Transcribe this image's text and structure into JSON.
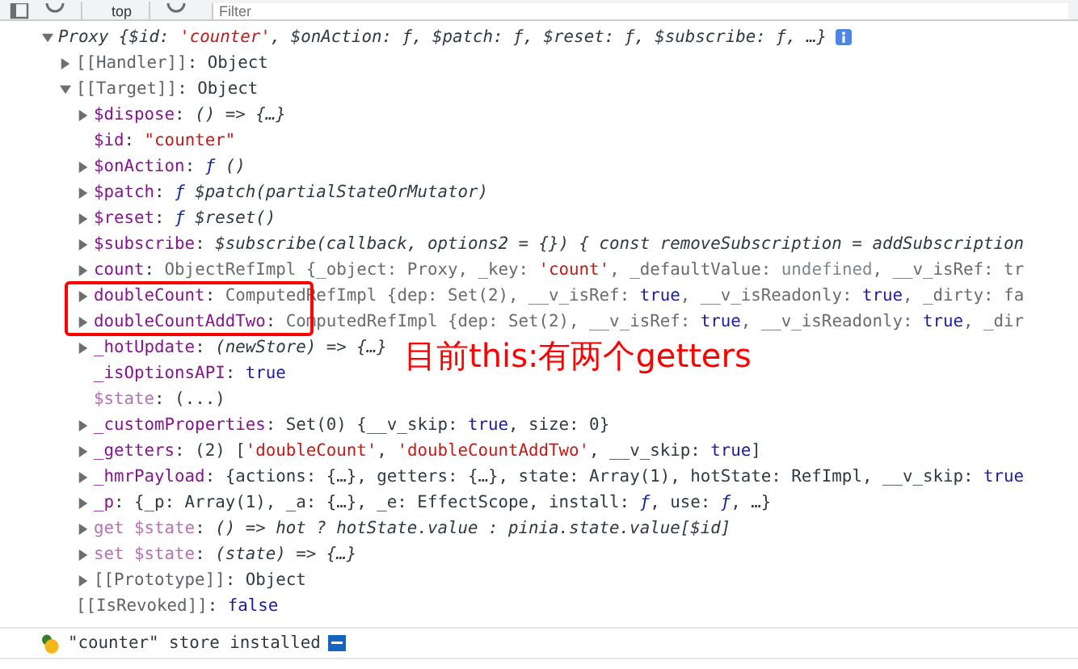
{
  "toolbar": {
    "context": "top",
    "filter": {
      "placeholder": "Filter"
    }
  },
  "console_tree": [
    {
      "kind": "node",
      "expanded": true,
      "segments": [
        {
          "kind": "summary",
          "text": "Proxy {$id: "
        },
        {
          "kind": "summary_string",
          "text": "'counter'"
        },
        {
          "kind": "summary",
          "text": ", $onAction: ƒ, $patch: ƒ, $reset: ƒ, $subscribe: ƒ, …}"
        }
      ],
      "children": [
        {
          "kind": "node",
          "expanded": false,
          "segments": [
            {
              "kind": "internal",
              "text": "[[Handler]]"
            },
            {
              "kind": "plain",
              "text": ": Object"
            }
          ]
        },
        {
          "kind": "node",
          "expanded": true,
          "segments": [
            {
              "kind": "internal",
              "text": "[[Target]]"
            },
            {
              "kind": "plain",
              "text": ": Object"
            }
          ],
          "children": [
            {
              "kind": "node",
              "expanded": false,
              "segments": [
                {
                  "kind": "key",
                  "text": "$dispose"
                },
                {
                  "kind": "plain",
                  "text": ": "
                },
                {
                  "kind": "italic",
                  "text": "() => {…}"
                }
              ]
            },
            {
              "kind": "leaf",
              "segments": [
                {
                  "kind": "key",
                  "text": "$id"
                },
                {
                  "kind": "plain",
                  "text": ": "
                },
                {
                  "kind": "string",
                  "text": "\"counter\""
                }
              ]
            },
            {
              "kind": "node",
              "expanded": false,
              "segments": [
                {
                  "kind": "key",
                  "text": "$onAction"
                },
                {
                  "kind": "plain",
                  "text": ": "
                },
                {
                  "kind": "fn",
                  "text": "ƒ "
                },
                {
                  "kind": "italic",
                  "text": "()"
                }
              ]
            },
            {
              "kind": "node",
              "expanded": false,
              "segments": [
                {
                  "kind": "key",
                  "text": "$patch"
                },
                {
                  "kind": "plain",
                  "text": ": "
                },
                {
                  "kind": "fn",
                  "text": "ƒ "
                },
                {
                  "kind": "italic",
                  "text": "$patch(partialStateOrMutator)"
                }
              ]
            },
            {
              "kind": "node",
              "expanded": false,
              "segments": [
                {
                  "kind": "key",
                  "text": "$reset"
                },
                {
                  "kind": "plain",
                  "text": ": "
                },
                {
                  "kind": "fn",
                  "text": "ƒ "
                },
                {
                  "kind": "italic",
                  "text": "$reset()"
                }
              ]
            },
            {
              "kind": "node",
              "expanded": false,
              "segments": [
                {
                  "kind": "key",
                  "text": "$subscribe"
                },
                {
                  "kind": "plain",
                  "text": ": "
                },
                {
                  "kind": "italic",
                  "text": "$subscribe(callback, options2 = {}) { const removeSubscription = addSubscription"
                }
              ]
            },
            {
              "kind": "node",
              "expanded": false,
              "segments": [
                {
                  "kind": "key",
                  "text": "count"
                },
                {
                  "kind": "plain",
                  "text": ": "
                },
                {
                  "kind": "preview",
                  "text": "ObjectRefImpl {_object: Proxy, _key: "
                },
                {
                  "kind": "string",
                  "text": "'count'"
                },
                {
                  "kind": "preview",
                  "text": ", _defaultValue: "
                },
                {
                  "kind": "undef",
                  "text": "undefined"
                },
                {
                  "kind": "preview",
                  "text": ", __v_isRef: tr"
                }
              ]
            },
            {
              "kind": "node",
              "expanded": false,
              "segments": [
                {
                  "kind": "key",
                  "text": "doubleCount"
                },
                {
                  "kind": "plain",
                  "text": ": "
                },
                {
                  "kind": "preview",
                  "text": "ComputedRefImpl {dep: Set(2), __v_isRef: "
                },
                {
                  "kind": "keyword",
                  "text": "true"
                },
                {
                  "kind": "preview",
                  "text": ", __v_isReadonly: "
                },
                {
                  "kind": "keyword",
                  "text": "true"
                },
                {
                  "kind": "preview",
                  "text": ", _dirty: fa"
                }
              ]
            },
            {
              "kind": "node",
              "expanded": false,
              "segments": [
                {
                  "kind": "key",
                  "text": "doubleCountAddTwo"
                },
                {
                  "kind": "plain",
                  "text": ": "
                },
                {
                  "kind": "preview",
                  "text": "ComputedRefImpl {dep: Set(2), __v_isRef: "
                },
                {
                  "kind": "keyword",
                  "text": "true"
                },
                {
                  "kind": "preview",
                  "text": ", __v_isReadonly: "
                },
                {
                  "kind": "keyword",
                  "text": "true"
                },
                {
                  "kind": "preview",
                  "text": ", _dir"
                }
              ]
            },
            {
              "kind": "node",
              "expanded": false,
              "segments": [
                {
                  "kind": "key",
                  "text": "_hotUpdate"
                },
                {
                  "kind": "plain",
                  "text": ": "
                },
                {
                  "kind": "italic",
                  "text": "(newStore) => {…}"
                }
              ]
            },
            {
              "kind": "leaf",
              "segments": [
                {
                  "kind": "key",
                  "text": "_isOptionsAPI"
                },
                {
                  "kind": "plain",
                  "text": ": "
                },
                {
                  "kind": "keyword",
                  "text": "true"
                }
              ]
            },
            {
              "kind": "leaf",
              "segments": [
                {
                  "kind": "dimkey",
                  "text": "$state"
                },
                {
                  "kind": "plain",
                  "text": ": (...)"
                }
              ]
            },
            {
              "kind": "node",
              "expanded": false,
              "segments": [
                {
                  "kind": "key",
                  "text": "_customProperties"
                },
                {
                  "kind": "plain",
                  "text": ": Set(0) {__v_skip: "
                },
                {
                  "kind": "keyword",
                  "text": "true"
                },
                {
                  "kind": "plain",
                  "text": ", size: 0}"
                }
              ]
            },
            {
              "kind": "node",
              "expanded": false,
              "segments": [
                {
                  "kind": "key",
                  "text": "_getters"
                },
                {
                  "kind": "plain",
                  "text": ": (2) ["
                },
                {
                  "kind": "string",
                  "text": "'doubleCount'"
                },
                {
                  "kind": "plain",
                  "text": ", "
                },
                {
                  "kind": "string",
                  "text": "'doubleCountAddTwo'"
                },
                {
                  "kind": "plain",
                  "text": ", __v_skip: "
                },
                {
                  "kind": "keyword",
                  "text": "true"
                },
                {
                  "kind": "plain",
                  "text": "]"
                }
              ]
            },
            {
              "kind": "node",
              "expanded": false,
              "segments": [
                {
                  "kind": "key",
                  "text": "_hmrPayload"
                },
                {
                  "kind": "plain",
                  "text": ": {actions: {…}, getters: {…}, state: Array(1), hotState: RefImpl, __v_skip: "
                },
                {
                  "kind": "keyword",
                  "text": "true"
                }
              ]
            },
            {
              "kind": "node",
              "expanded": false,
              "segments": [
                {
                  "kind": "key",
                  "text": "_p"
                },
                {
                  "kind": "plain",
                  "text": ": {_p: Array(1), _a: {…}, _e: EffectScope, install: "
                },
                {
                  "kind": "fn",
                  "text": "ƒ"
                },
                {
                  "kind": "plain",
                  "text": ", use: "
                },
                {
                  "kind": "fn",
                  "text": "ƒ"
                },
                {
                  "kind": "plain",
                  "text": ", …}"
                }
              ]
            },
            {
              "kind": "node",
              "expanded": false,
              "segments": [
                {
                  "kind": "dimkey",
                  "text": "get $state"
                },
                {
                  "kind": "plain",
                  "text": ": "
                },
                {
                  "kind": "italic",
                  "text": "() => hot ? hotState.value : pinia.state.value[$id]"
                }
              ]
            },
            {
              "kind": "node",
              "expanded": false,
              "segments": [
                {
                  "kind": "dimkey",
                  "text": "set $state"
                },
                {
                  "kind": "plain",
                  "text": ": "
                },
                {
                  "kind": "italic",
                  "text": "(state) => {…}"
                }
              ]
            },
            {
              "kind": "node",
              "expanded": false,
              "segments": [
                {
                  "kind": "internal",
                  "text": "[[Prototype]]"
                },
                {
                  "kind": "plain",
                  "text": ": Object"
                }
              ]
            }
          ]
        },
        {
          "kind": "leaf",
          "segments": [
            {
              "kind": "internal",
              "text": "[[IsRevoked]]"
            },
            {
              "kind": "plain",
              "text": ": "
            },
            {
              "kind": "keyword",
              "text": "false"
            }
          ]
        }
      ]
    }
  ],
  "annotation": {
    "text": "目前this:有两个getters"
  },
  "log_message": {
    "text": "\"counter\" store installed"
  }
}
